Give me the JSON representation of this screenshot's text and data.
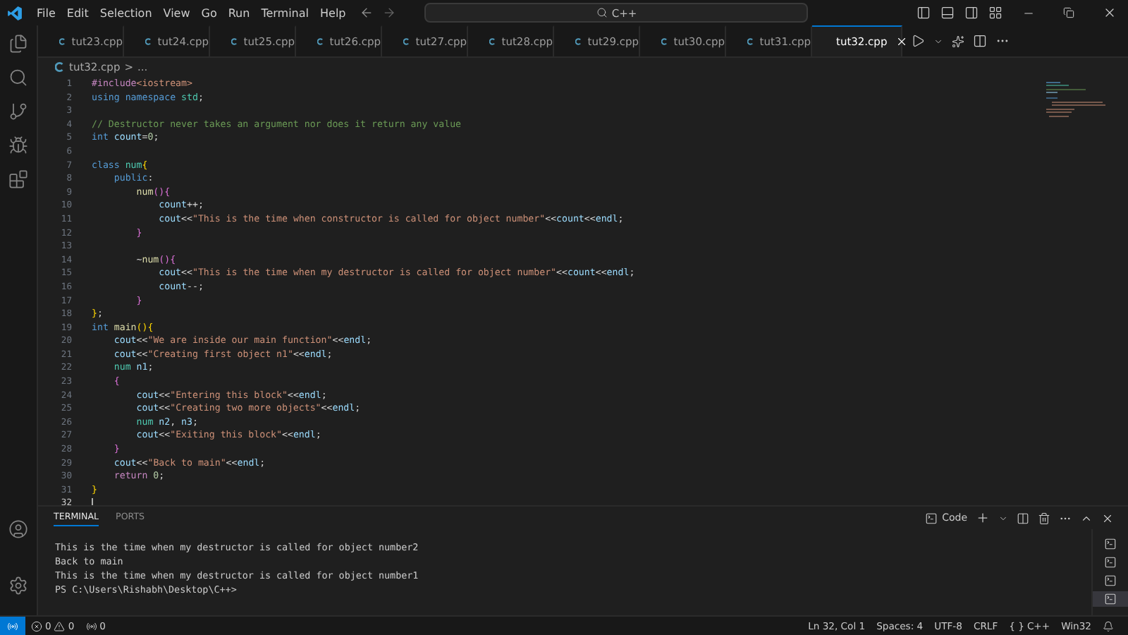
{
  "menu": [
    "File",
    "Edit",
    "Selection",
    "View",
    "Go",
    "Run",
    "Terminal",
    "Help"
  ],
  "search": {
    "value": "C++"
  },
  "tabs": [
    {
      "label": "tut23.cpp",
      "selected": false
    },
    {
      "label": "tut24.cpp",
      "selected": false
    },
    {
      "label": "tut25.cpp",
      "selected": false
    },
    {
      "label": "tut26.cpp",
      "selected": false
    },
    {
      "label": "tut27.cpp",
      "selected": false
    },
    {
      "label": "tut28.cpp",
      "selected": false
    },
    {
      "label": "tut29.cpp",
      "selected": false
    },
    {
      "label": "tut30.cpp",
      "selected": false
    },
    {
      "label": "tut31.cpp",
      "selected": false
    },
    {
      "label": "tut32.cpp",
      "selected": true
    }
  ],
  "breadcrumb": {
    "file": "tut32.cpp",
    "separator": ">",
    "rest": "..."
  },
  "code": [
    {
      "n": "1",
      "tokens": [
        {
          "kind": "directive",
          "text": "#include"
        },
        {
          "kind": "string",
          "text": "<iostream>"
        }
      ]
    },
    {
      "n": "2",
      "tokens": [
        {
          "kind": "keyword",
          "text": "using namespace "
        },
        {
          "kind": "type",
          "text": "std"
        },
        {
          "kind": "plain",
          "text": ";"
        }
      ]
    },
    {
      "n": "3"
    },
    {
      "n": "4",
      "tokens": [
        {
          "kind": "comment",
          "text": "// Destructor never takes an argument nor does it return any value"
        }
      ]
    },
    {
      "n": "5",
      "tokens": [
        {
          "kind": "keyword",
          "text": "int "
        },
        {
          "kind": "variable",
          "text": "count"
        },
        {
          "kind": "plain",
          "text": "="
        },
        {
          "kind": "number",
          "text": "0"
        },
        {
          "kind": "plain",
          "text": ";"
        }
      ]
    },
    {
      "n": "6"
    },
    {
      "n": "7",
      "tokens": [
        {
          "kind": "keyword",
          "text": "class "
        },
        {
          "kind": "type",
          "text": "num"
        },
        {
          "kind": "bracket1",
          "text": "{"
        }
      ]
    },
    {
      "n": "8",
      "tokens": [
        {
          "kind": "keyword",
          "text": "    public"
        },
        {
          "kind": "plain",
          "text": ":"
        }
      ]
    },
    {
      "n": "9",
      "tokens": [
        {
          "kind": "function",
          "text": "        num"
        },
        {
          "kind": "bracket2",
          "text": "(){"
        }
      ]
    },
    {
      "n": "10",
      "tokens": [
        {
          "kind": "variable",
          "text": "            count"
        },
        {
          "kind": "plain",
          "text": "++;"
        }
      ]
    },
    {
      "n": "11",
      "tokens": [
        {
          "kind": "variable",
          "text": "            cout"
        },
        {
          "kind": "plain",
          "text": "<<"
        },
        {
          "kind": "string",
          "text": "\"This is the time when constructor is called for object number\""
        },
        {
          "kind": "plain",
          "text": "<<"
        },
        {
          "kind": "variable",
          "text": "count"
        },
        {
          "kind": "plain",
          "text": "<<"
        },
        {
          "kind": "variable",
          "text": "endl"
        },
        {
          "kind": "plain",
          "text": ";"
        }
      ]
    },
    {
      "n": "12",
      "tokens": [
        {
          "kind": "bracket2",
          "text": "        }"
        }
      ]
    },
    {
      "n": "13"
    },
    {
      "n": "14",
      "tokens": [
        {
          "kind": "plain",
          "text": "        ~"
        },
        {
          "kind": "function",
          "text": "num"
        },
        {
          "kind": "bracket2",
          "text": "(){"
        }
      ]
    },
    {
      "n": "15",
      "tokens": [
        {
          "kind": "variable",
          "text": "            cout"
        },
        {
          "kind": "plain",
          "text": "<<"
        },
        {
          "kind": "string",
          "text": "\"This is the time when my destructor is called for object number\""
        },
        {
          "kind": "plain",
          "text": "<<"
        },
        {
          "kind": "variable",
          "text": "count"
        },
        {
          "kind": "plain",
          "text": "<<"
        },
        {
          "kind": "variable",
          "text": "endl"
        },
        {
          "kind": "plain",
          "text": ";"
        }
      ]
    },
    {
      "n": "16",
      "tokens": [
        {
          "kind": "variable",
          "text": "            count"
        },
        {
          "kind": "plain",
          "text": "--;"
        }
      ]
    },
    {
      "n": "17",
      "tokens": [
        {
          "kind": "bracket2",
          "text": "        }"
        }
      ]
    },
    {
      "n": "18",
      "tokens": [
        {
          "kind": "bracket1",
          "text": "}"
        },
        {
          "kind": "plain",
          "text": ";"
        }
      ]
    },
    {
      "n": "19",
      "tokens": [
        {
          "kind": "keyword",
          "text": "int "
        },
        {
          "kind": "function",
          "text": "main"
        },
        {
          "kind": "bracket1",
          "text": "(){"
        }
      ]
    },
    {
      "n": "20",
      "tokens": [
        {
          "kind": "variable",
          "text": "    cout"
        },
        {
          "kind": "plain",
          "text": "<<"
        },
        {
          "kind": "string",
          "text": "\"We are inside our main function\""
        },
        {
          "kind": "plain",
          "text": "<<"
        },
        {
          "kind": "variable",
          "text": "endl"
        },
        {
          "kind": "plain",
          "text": ";"
        }
      ]
    },
    {
      "n": "21",
      "tokens": [
        {
          "kind": "variable",
          "text": "    cout"
        },
        {
          "kind": "plain",
          "text": "<<"
        },
        {
          "kind": "string",
          "text": "\"Creating first object n1\""
        },
        {
          "kind": "plain",
          "text": "<<"
        },
        {
          "kind": "variable",
          "text": "endl"
        },
        {
          "kind": "plain",
          "text": ";"
        }
      ]
    },
    {
      "n": "22",
      "tokens": [
        {
          "kind": "type",
          "text": "    num "
        },
        {
          "kind": "variable",
          "text": "n1"
        },
        {
          "kind": "plain",
          "text": ";"
        }
      ]
    },
    {
      "n": "23",
      "tokens": [
        {
          "kind": "bracket2",
          "text": "    {"
        }
      ]
    },
    {
      "n": "24",
      "tokens": [
        {
          "kind": "variable",
          "text": "        cout"
        },
        {
          "kind": "plain",
          "text": "<<"
        },
        {
          "kind": "string",
          "text": "\"Entering this block\""
        },
        {
          "kind": "plain",
          "text": "<<"
        },
        {
          "kind": "variable",
          "text": "endl"
        },
        {
          "kind": "plain",
          "text": ";"
        }
      ]
    },
    {
      "n": "25",
      "tokens": [
        {
          "kind": "variable",
          "text": "        cout"
        },
        {
          "kind": "plain",
          "text": "<<"
        },
        {
          "kind": "string",
          "text": "\"Creating two more objects\""
        },
        {
          "kind": "plain",
          "text": "<<"
        },
        {
          "kind": "variable",
          "text": "endl"
        },
        {
          "kind": "plain",
          "text": ";"
        }
      ]
    },
    {
      "n": "26",
      "tokens": [
        {
          "kind": "type",
          "text": "        num "
        },
        {
          "kind": "variable",
          "text": "n2"
        },
        {
          "kind": "plain",
          "text": ", "
        },
        {
          "kind": "variable",
          "text": "n3"
        },
        {
          "kind": "plain",
          "text": ";"
        }
      ]
    },
    {
      "n": "27",
      "tokens": [
        {
          "kind": "variable",
          "text": "        cout"
        },
        {
          "kind": "plain",
          "text": "<<"
        },
        {
          "kind": "string",
          "text": "\"Exiting this block\""
        },
        {
          "kind": "plain",
          "text": "<<"
        },
        {
          "kind": "variable",
          "text": "endl"
        },
        {
          "kind": "plain",
          "text": ";"
        }
      ]
    },
    {
      "n": "28",
      "tokens": [
        {
          "kind": "bracket2",
          "text": "    }"
        }
      ]
    },
    {
      "n": "29",
      "tokens": [
        {
          "kind": "variable",
          "text": "    cout"
        },
        {
          "kind": "plain",
          "text": "<<"
        },
        {
          "kind": "string",
          "text": "\"Back to main\""
        },
        {
          "kind": "plain",
          "text": "<<"
        },
        {
          "kind": "variable",
          "text": "endl"
        },
        {
          "kind": "plain",
          "text": ";"
        }
      ]
    },
    {
      "n": "30",
      "tokens": [
        {
          "kind": "control",
          "text": "    return "
        },
        {
          "kind": "number",
          "text": "0"
        },
        {
          "kind": "plain",
          "text": ";"
        }
      ]
    },
    {
      "n": "31",
      "tokens": [
        {
          "kind": "bracket1",
          "text": "}"
        }
      ]
    },
    {
      "n": "32",
      "cursor": true
    }
  ],
  "panel": {
    "tabs": [
      {
        "label": "TERMINAL",
        "selected": true
      },
      {
        "label": "PORTS",
        "selected": false
      }
    ],
    "profile": "Code",
    "terminal_lines": [
      "This is the time when my destructor is called for object number2",
      "Back to main",
      "This is the time when my destructor is called for object number1",
      "PS C:\\Users\\Rishabh\\Desktop\\C++>"
    ],
    "terminals": [
      {
        "selected": false
      },
      {
        "selected": false
      },
      {
        "selected": false
      },
      {
        "selected": true
      }
    ]
  },
  "status_bar": {
    "errors": "0",
    "warnings": "0",
    "ports": "0",
    "position": "Ln 32, Col 1",
    "spaces": "Spaces: 4",
    "encoding": "UTF-8",
    "eol": "CRLF",
    "language_braces": "{ }",
    "language": "C++",
    "platform": "Win32"
  }
}
